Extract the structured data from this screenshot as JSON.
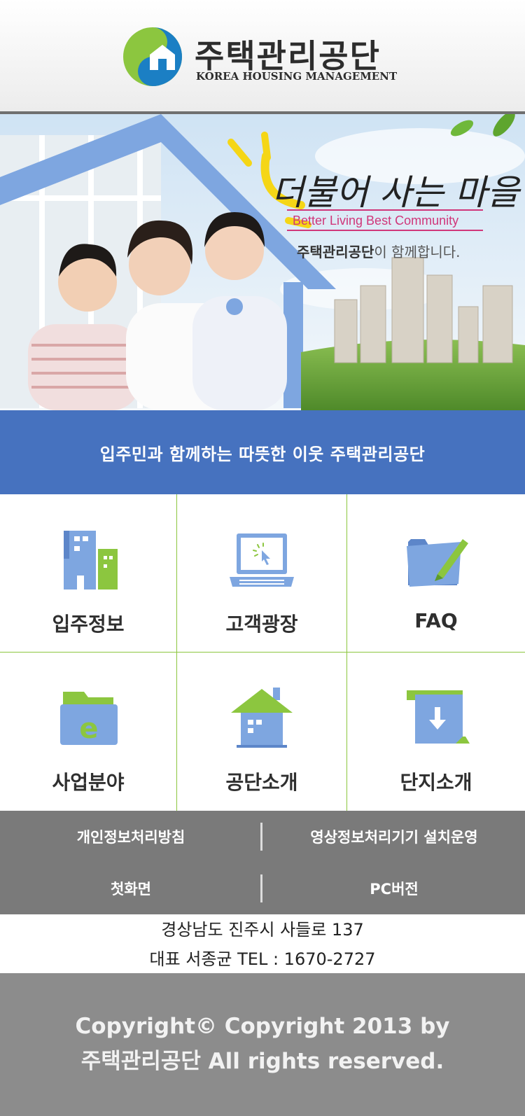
{
  "header": {
    "logo_korean": "주택관리공단",
    "logo_english": "KOREA HOUSING MANAGEMENT"
  },
  "hero": {
    "slogan": "더불어 사는 마을",
    "slogan_en": "Better Living Best Community",
    "sub_brand": "주택관리공단",
    "sub_suffix": "이 함께합니다."
  },
  "tagline": "입주민과 함께하는 따뜻한 이웃 주택관리공단",
  "menu": [
    {
      "label": "입주정보",
      "icon": "buildings-icon"
    },
    {
      "label": "고객광장",
      "icon": "laptop-icon"
    },
    {
      "label": "FAQ",
      "icon": "folder-pen-icon"
    },
    {
      "label": "사업분야",
      "icon": "folder-e-icon"
    },
    {
      "label": "공단소개",
      "icon": "house-icon"
    },
    {
      "label": "단지소개",
      "icon": "scroll-download-icon"
    }
  ],
  "links": {
    "privacy": "개인정보처리방침",
    "cctv": "영상정보처리기기 설치운영",
    "home": "첫화면",
    "pc": "PC버전"
  },
  "address": {
    "line1": "경상남도 진주시 사들로 137",
    "line2": "대표 서종균 TEL : 1670-2727"
  },
  "footer": {
    "line1": "Copyright© Copyright 2013 by",
    "line2": "주택관리공단 All rights reserved."
  },
  "colors": {
    "primary_blue": "#4672bf",
    "accent_green": "#8cc63f",
    "link_bar": "#7a7a7a",
    "footer_bg": "#8c8c8c"
  }
}
